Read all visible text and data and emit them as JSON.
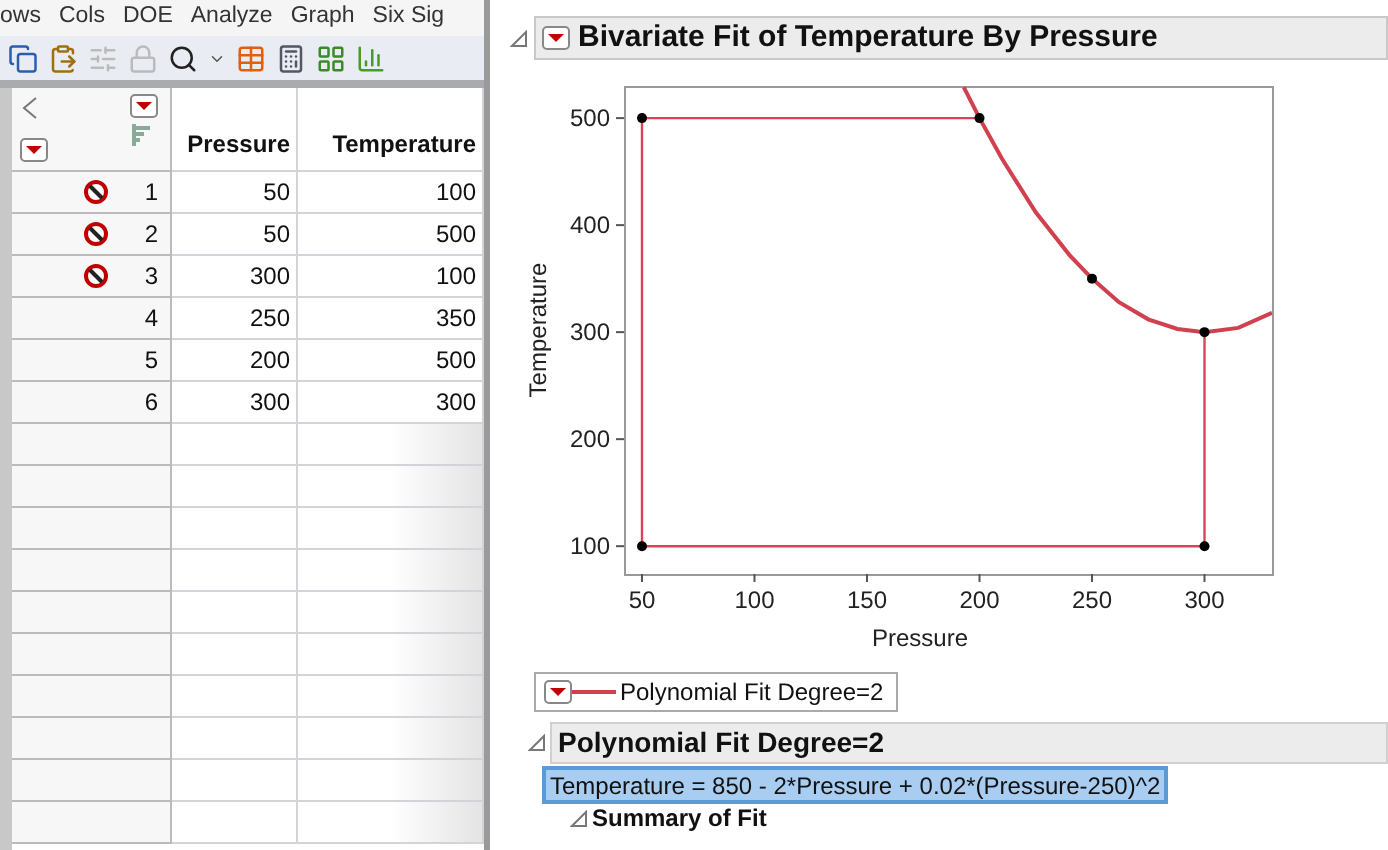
{
  "menu": [
    "ows",
    "Cols",
    "DOE",
    "Analyze",
    "Graph",
    "Six Sig"
  ],
  "table": {
    "columns": [
      "Pressure",
      "Temperature"
    ],
    "rows": [
      {
        "number": "1",
        "excluded": true,
        "cells": [
          "50",
          "100"
        ]
      },
      {
        "number": "2",
        "excluded": true,
        "cells": [
          "50",
          "500"
        ]
      },
      {
        "number": "3",
        "excluded": true,
        "cells": [
          "300",
          "100"
        ]
      },
      {
        "number": "4",
        "excluded": false,
        "cells": [
          "250",
          "350"
        ]
      },
      {
        "number": "5",
        "excluded": false,
        "cells": [
          "200",
          "500"
        ]
      },
      {
        "number": "6",
        "excluded": false,
        "cells": [
          "300",
          "300"
        ]
      }
    ]
  },
  "report": {
    "title": "Bivariate Fit of Temperature By Pressure",
    "expanded": true,
    "chart_data": {
      "type": "scatter",
      "xlabel": "Pressure",
      "ylabel": "Temperature",
      "xlim": [
        42,
        330
      ],
      "ylim": [
        74,
        530
      ],
      "xticks": [
        50,
        100,
        150,
        200,
        250,
        300
      ],
      "yticks": [
        100,
        200,
        300,
        400,
        500
      ],
      "series": [
        {
          "type": "scatter",
          "color": "#000000",
          "x": [
            50,
            50,
            300,
            250,
            200,
            300
          ],
          "values": [
            100,
            500,
            100,
            350,
            500,
            300
          ]
        },
        {
          "type": "line",
          "color": "#e0405a",
          "x": [
            200,
            50,
            50,
            300,
            300
          ],
          "values": [
            500,
            500,
            100,
            100,
            300
          ]
        },
        {
          "name": "Polynomial Fit Degree=2",
          "type": "line",
          "color": "#d0404f",
          "x": [
            193,
            200,
            210,
            225,
            240,
            250,
            262,
            275,
            288,
            300,
            315,
            330
          ],
          "values": [
            529,
            500,
            462,
            412,
            372,
            350,
            328,
            312,
            303,
            300,
            304,
            318
          ]
        }
      ]
    },
    "fit": {
      "title": "Polynomial Fit Degree=2",
      "equation": "Temperature = 850 - 2*Pressure + 0.02*(Pressure-250)^2",
      "selected": true
    },
    "subsection": {
      "title": "Summary of Fit"
    }
  }
}
